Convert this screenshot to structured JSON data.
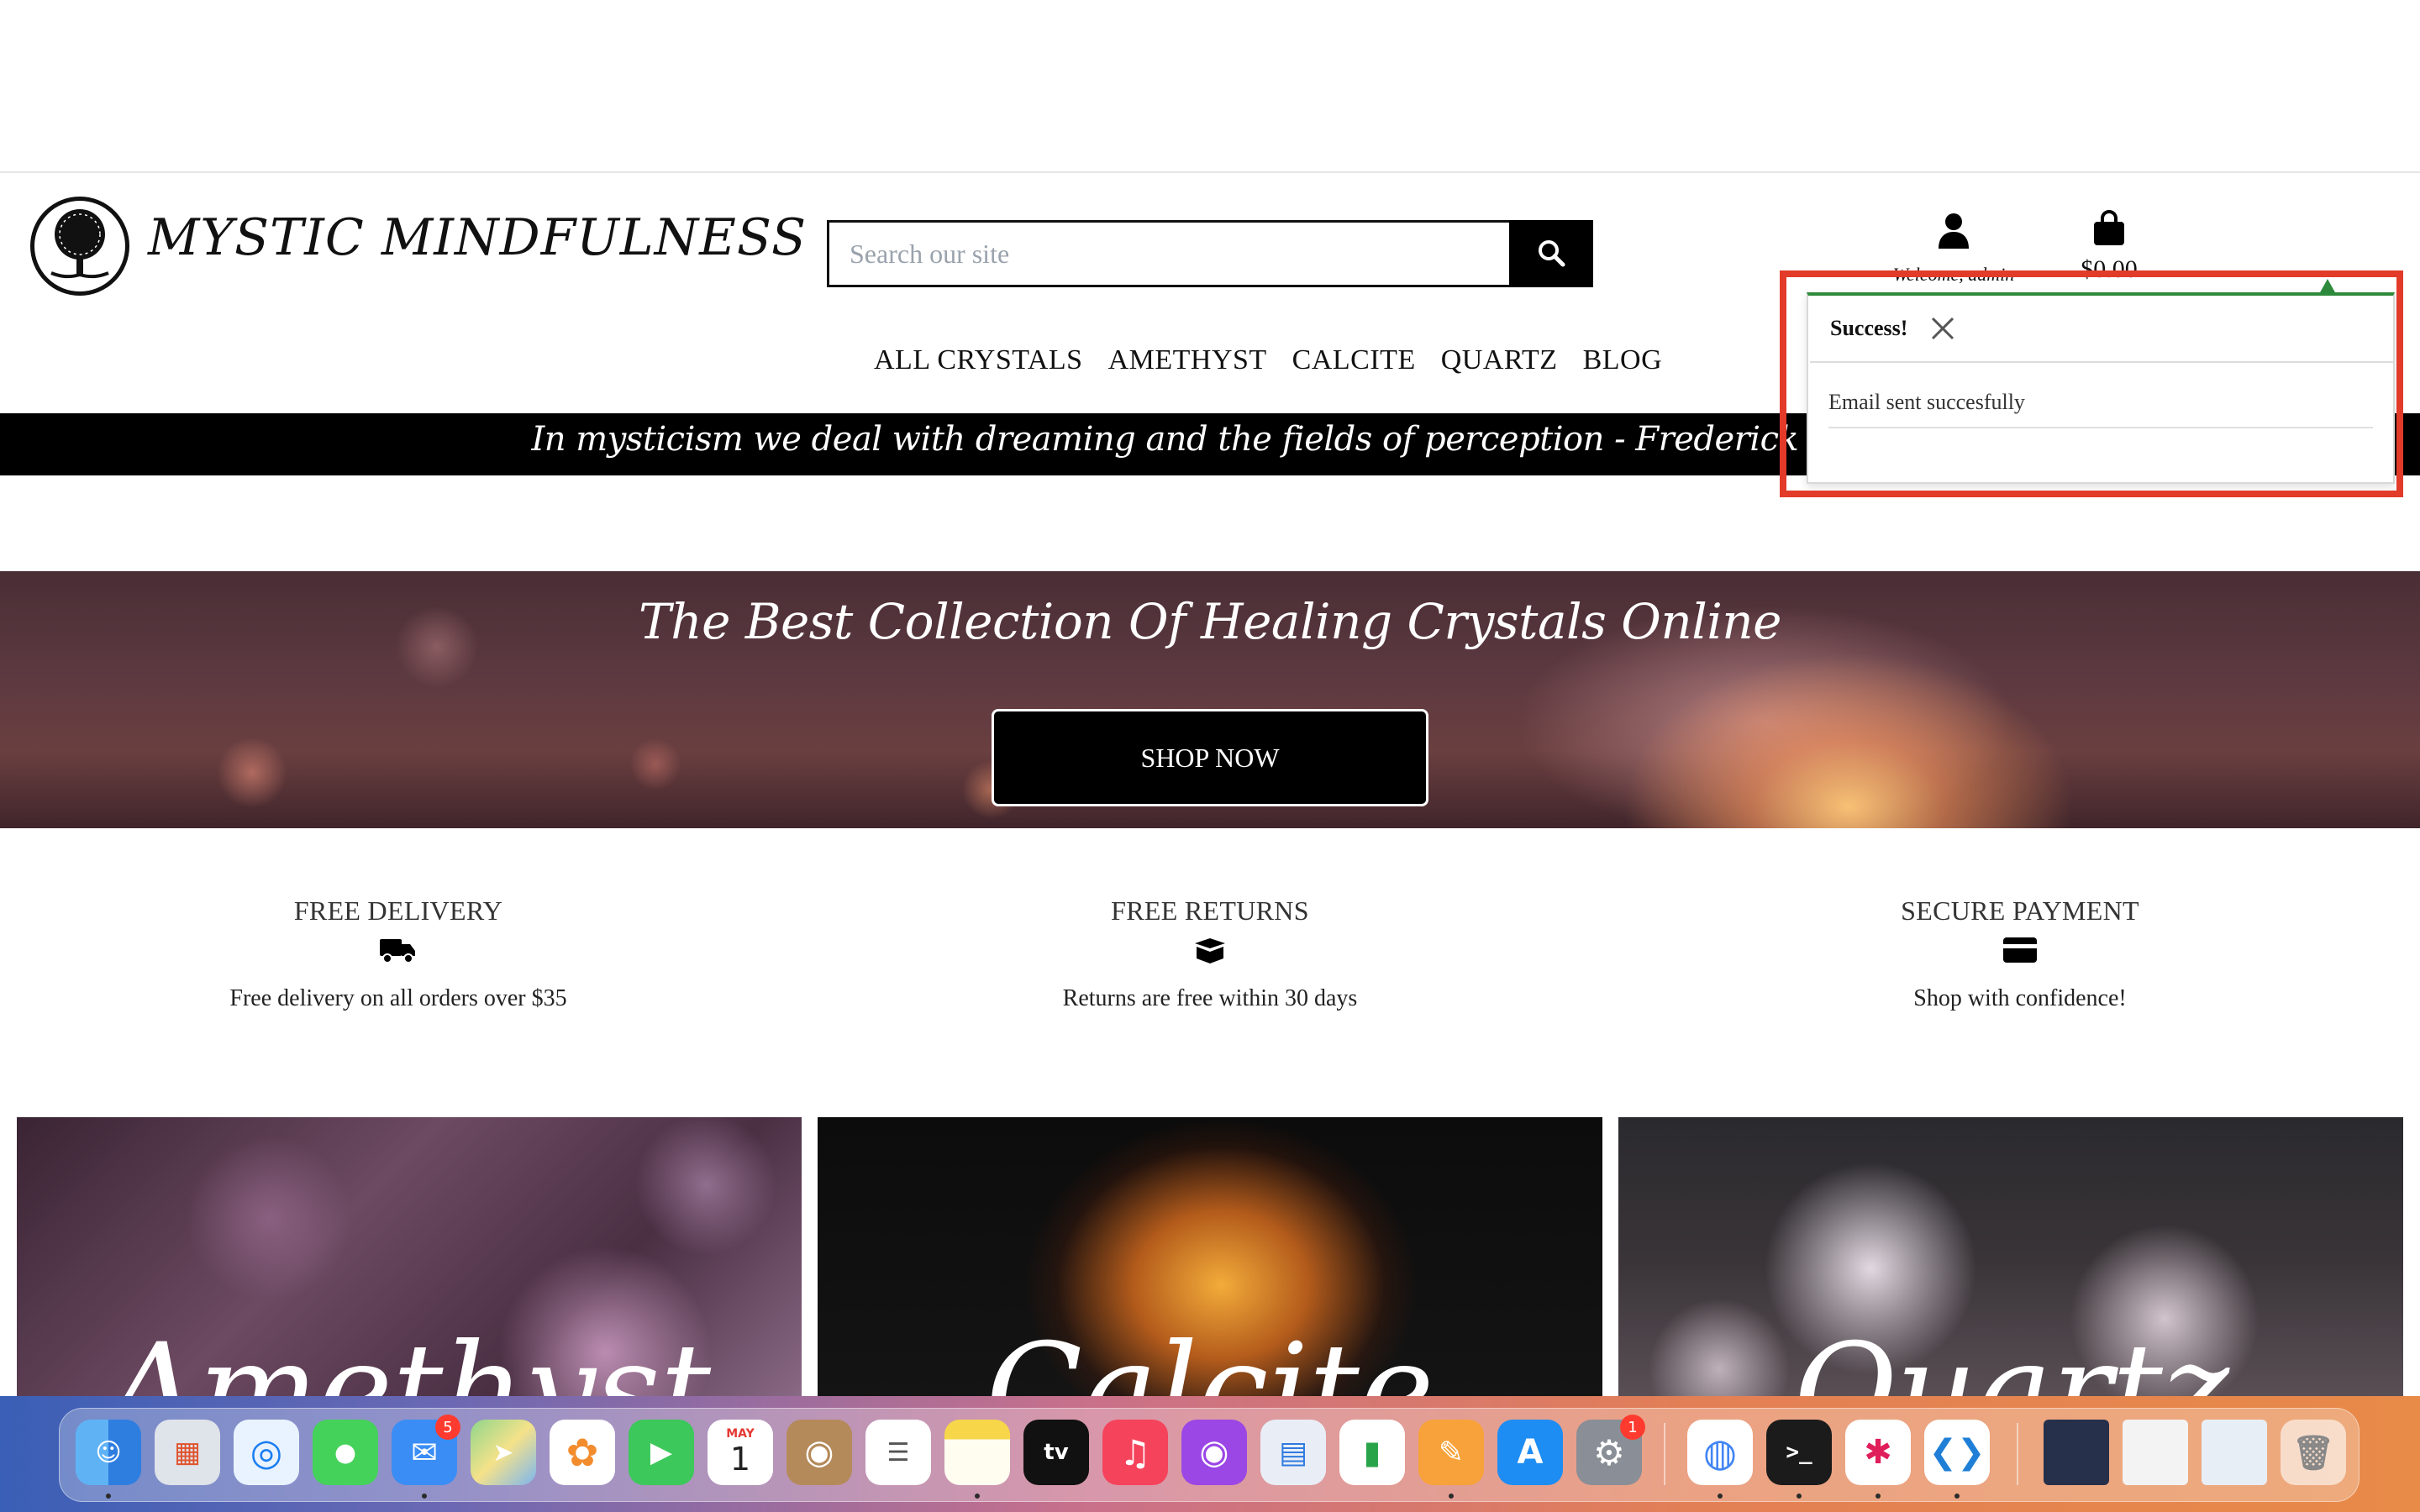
{
  "header": {
    "brand": "MYSTIC MINDFULNESS",
    "search_placeholder": "Search our site",
    "account_label": "Welcome, admin",
    "bag_total": "$0.00"
  },
  "nav": {
    "items": [
      {
        "label": "ALL CRYSTALS"
      },
      {
        "label": "AMETHYST"
      },
      {
        "label": "CALCITE"
      },
      {
        "label": "QUARTZ"
      },
      {
        "label": "BLOG"
      }
    ]
  },
  "quote_bar": {
    "text": "In mysticism we deal with dreaming and the fields of perception - Frederick Lenz"
  },
  "hero": {
    "title": "The Best Collection Of Healing Crystals Online",
    "cta": "SHOP NOW"
  },
  "features": [
    {
      "title": "FREE DELIVERY",
      "icon": "truck-icon",
      "text": "Free delivery on all orders over $35"
    },
    {
      "title": "FREE RETURNS",
      "icon": "box-icon",
      "text": "Returns are free within 30 days"
    },
    {
      "title": "SECURE PAYMENT",
      "icon": "credit-card-icon",
      "text": "Shop with confidence!"
    }
  ],
  "categories": [
    {
      "label": "Amethyst"
    },
    {
      "label": "Calcite"
    },
    {
      "label": "Quartz"
    }
  ],
  "toast": {
    "title": "Success!",
    "message": "Email sent succesfully",
    "accent_color": "#2e8a3c",
    "highlight_color": "#e23b2a"
  },
  "dock": {
    "apps": [
      {
        "name": "Finder",
        "icon": "finder-icon"
      },
      {
        "name": "Launchpad",
        "icon": "launchpad-icon"
      },
      {
        "name": "Safari",
        "icon": "safari-icon"
      },
      {
        "name": "Messages",
        "icon": "messages-icon"
      },
      {
        "name": "Mail",
        "icon": "mail-icon",
        "badge": "5"
      },
      {
        "name": "Maps",
        "icon": "maps-icon"
      },
      {
        "name": "Photos",
        "icon": "photos-icon"
      },
      {
        "name": "FaceTime",
        "icon": "facetime-icon"
      },
      {
        "name": "Calendar",
        "icon": "calendar-icon",
        "month": "MAY",
        "day": "1"
      },
      {
        "name": "Contacts",
        "icon": "contacts-icon"
      },
      {
        "name": "Reminders",
        "icon": "reminders-icon"
      },
      {
        "name": "Notes",
        "icon": "notes-icon"
      },
      {
        "name": "TV",
        "icon": "tv-icon",
        "text": "tv"
      },
      {
        "name": "Music",
        "icon": "music-icon"
      },
      {
        "name": "Podcasts",
        "icon": "podcasts-icon"
      },
      {
        "name": "Keynote",
        "icon": "keynote-icon"
      },
      {
        "name": "Numbers",
        "icon": "numbers-icon"
      },
      {
        "name": "Pages",
        "icon": "pages-icon"
      },
      {
        "name": "App Store",
        "icon": "app-store-icon"
      },
      {
        "name": "System Settings",
        "icon": "settings-icon",
        "badge": "1"
      },
      {
        "name": "Chrome",
        "icon": "chrome-icon"
      },
      {
        "name": "Terminal",
        "icon": "terminal-icon"
      },
      {
        "name": "Slack",
        "icon": "slack-icon"
      },
      {
        "name": "VS Code",
        "icon": "vscode-icon"
      },
      {
        "name": "Window 1",
        "icon": "window-thumbnail-icon"
      },
      {
        "name": "Window 2",
        "icon": "window-thumbnail-icon"
      },
      {
        "name": "Window 3",
        "icon": "window-thumbnail-icon"
      },
      {
        "name": "Trash",
        "icon": "trash-icon"
      }
    ]
  }
}
